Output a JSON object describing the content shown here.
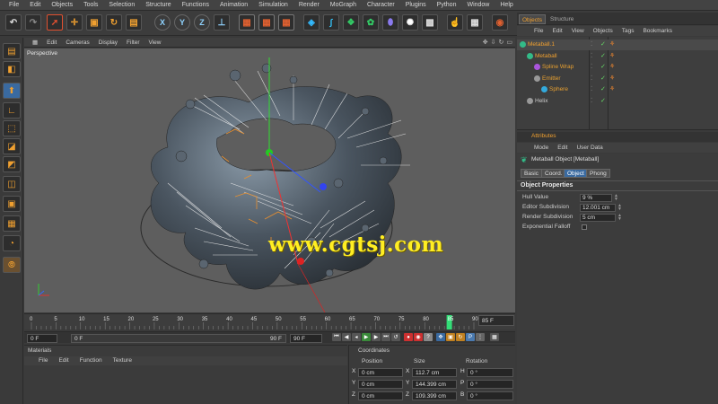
{
  "menubar": [
    "File",
    "Edit",
    "Objects",
    "Tools",
    "Selection",
    "Structure",
    "Functions",
    "Animation",
    "Simulation",
    "Render",
    "MoGraph",
    "Character",
    "Plugins",
    "Python",
    "Window",
    "Help"
  ],
  "toolbar": {
    "axis_x": "X",
    "axis_y": "Y",
    "axis_z": "Z"
  },
  "viewport": {
    "menu": [
      "Edit",
      "Cameras",
      "Display",
      "Filter",
      "View"
    ],
    "label": "Perspective",
    "watermark": "www.cgtsj.com"
  },
  "timeline": {
    "ticks": [
      "0",
      "5",
      "10",
      "15",
      "20",
      "25",
      "30",
      "35",
      "40",
      "45",
      "50",
      "55",
      "60",
      "65",
      "70",
      "75",
      "80",
      "85",
      "90"
    ],
    "current_marker": "85",
    "frame_display": "85 F",
    "start": "0 F",
    "range_start": "0 F",
    "range_end": "90 F",
    "end": "90 F"
  },
  "materials": {
    "title": "Materials",
    "menu": [
      "File",
      "Edit",
      "Function",
      "Texture"
    ]
  },
  "coordinates": {
    "title": "Coordinates",
    "headers": [
      "Position",
      "Size",
      "Rotation"
    ],
    "rows": [
      {
        "axis": "X",
        "pos": "0 cm",
        "size_axis": "X",
        "size": "112.7 cm",
        "rot_axis": "H",
        "rot": "0 °"
      },
      {
        "axis": "Y",
        "pos": "0 cm",
        "size_axis": "Y",
        "size": "144.399 cm",
        "rot_axis": "P",
        "rot": "0 °"
      },
      {
        "axis": "Z",
        "pos": "0 cm",
        "size_axis": "Z",
        "size": "109.399 cm",
        "rot_axis": "B",
        "rot": "0 °"
      }
    ]
  },
  "objects_panel": {
    "tabs": [
      "Objects",
      "Structure"
    ],
    "menu": [
      "File",
      "Edit",
      "View",
      "Objects",
      "Tags",
      "Bookmarks"
    ],
    "items": [
      {
        "name": "Metaball.1",
        "color": "#f0a030",
        "icon": "#33bb88",
        "indent": 12
      },
      {
        "name": "Metaball",
        "color": "#f0a030",
        "icon": "#33bb88",
        "indent": 20
      },
      {
        "name": "Spline Wrap",
        "color": "#e8a030",
        "icon": "#aa55dd",
        "indent": 28
      },
      {
        "name": "Emitter",
        "color": "#e8a030",
        "icon": "#999999",
        "indent": 28
      },
      {
        "name": "Sphere",
        "color": "#e8a030",
        "icon": "#33aadd",
        "indent": 36
      },
      {
        "name": "Helix",
        "color": "#cccccc",
        "icon": "#999999",
        "indent": 20
      }
    ]
  },
  "attributes": {
    "title": "Attributes",
    "menu": [
      "Mode",
      "Edit",
      "User Data"
    ],
    "object_name": "Metaball Object [Metaball]",
    "tabs": [
      "Basic",
      "Coord.",
      "Object",
      "Phong"
    ],
    "section": "Object Properties",
    "props": [
      {
        "label": "Hull Value",
        "value": "9 %"
      },
      {
        "label": "Editor Subdivision",
        "value": "12.001 cm"
      },
      {
        "label": "Render Subdivision",
        "value": "5 cm"
      },
      {
        "label": "Exponential Falloff",
        "value": ""
      }
    ]
  }
}
